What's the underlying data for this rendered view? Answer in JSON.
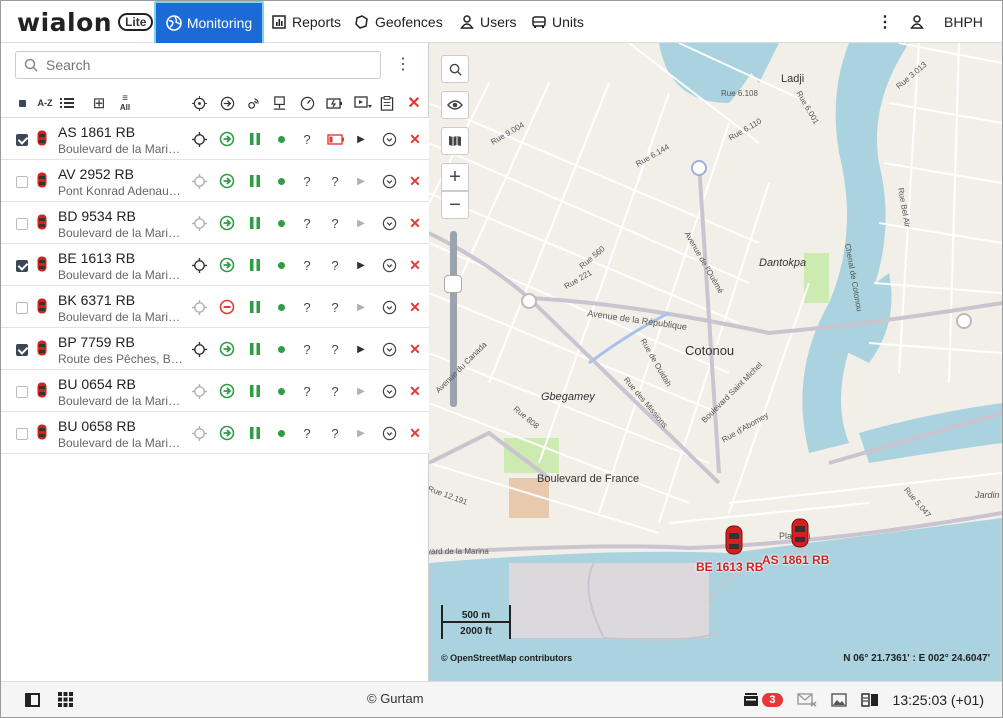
{
  "app": {
    "brand": "wialon",
    "edition": "Lite"
  },
  "nav": {
    "items": [
      {
        "label": "Monitoring",
        "active": true
      },
      {
        "label": "Reports"
      },
      {
        "label": "Geofences"
      },
      {
        "label": "Users"
      },
      {
        "label": "Units"
      }
    ],
    "user": "BHPH"
  },
  "panel": {
    "search_placeholder": "Search",
    "columns_all_label": "All",
    "sort_label": "A-Z",
    "units": [
      {
        "name": "AS 1861 RB",
        "address": "Boulevard de la Marina, Cotonou",
        "checked": true,
        "state": "moving",
        "battery_low": true
      },
      {
        "name": "AV 2952 RB",
        "address": "Pont Konrad Adenauer, Cotonou",
        "checked": false,
        "state": "moving",
        "battery_low": false
      },
      {
        "name": "BD 9534 RB",
        "address": "Boulevard de la Marina, Cotonou",
        "checked": false,
        "state": "moving",
        "battery_low": false
      },
      {
        "name": "BE 1613 RB",
        "address": "Boulevard de la Marina, Cotonou",
        "checked": true,
        "state": "moving",
        "battery_low": false
      },
      {
        "name": "BK 6371 RB",
        "address": "Boulevard de la Marina, Cotonou",
        "checked": false,
        "state": "stopped",
        "battery_low": false
      },
      {
        "name": "BP 7759 RB",
        "address": "Route des Pêches, Be...",
        "checked": true,
        "state": "moving",
        "battery_low": false
      },
      {
        "name": "BU 0654 RB",
        "address": "Boulevard de la Marina, Cotonou",
        "checked": false,
        "state": "moving",
        "battery_low": false
      },
      {
        "name": "BU 0658 RB",
        "address": "Boulevard de la Marina, Cotonou",
        "checked": false,
        "state": "moving",
        "battery_low": false
      }
    ],
    "unknown_value": "?"
  },
  "map": {
    "labels": [
      "Ladji",
      "Cotonou",
      "Dantokpa",
      "Gbegamey",
      "Boulevard de France",
      "Avenue de la République",
      "Rue des Missions",
      "Rue de Ouidah",
      "Boulevard Saint Michel",
      "Avenue du Canada",
      "Chenal de Cotonou",
      "Rue Bel Air",
      "Rue 3.013",
      "Rue 6.108",
      "Rue 6.001",
      "Rue 6.110",
      "Rue 6.144",
      "Rue 9.004",
      "Rue 560",
      "Rue 221",
      "Avenue de l'Ouémé",
      "Rue 808",
      "Rue 12.191",
      "Rue d'Abomey",
      "Rue 5.047",
      "Jardin",
      "Placodji",
      "vard de la Marina"
    ],
    "markers": [
      {
        "name": "BE 1613 RB"
      },
      {
        "name": "AS 1861 RB"
      }
    ],
    "scale_metric": "500 m",
    "scale_imperial": "2000 ft",
    "attribution": "© OpenStreetMap contributors",
    "coordinates": "N 06° 21.7361' : E 002° 24.6047'"
  },
  "footer": {
    "copyright": "© Gurtam",
    "notifications_count": "3",
    "time": "13:25:03 (+01)"
  },
  "colors": {
    "accent": "#1b6ad6",
    "moving": "#2e9e44",
    "stopped": "#e53935",
    "marker": "#d42020"
  }
}
